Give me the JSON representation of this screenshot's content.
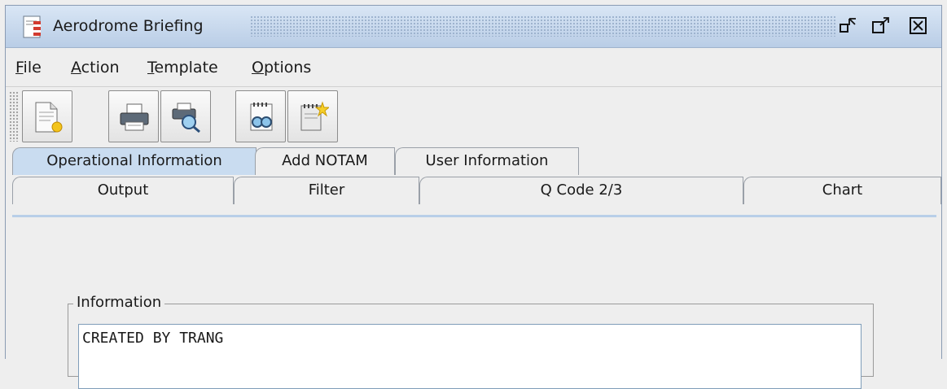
{
  "window": {
    "title": "Aerodrome Briefing",
    "controls": [
      "minimize-icon",
      "maximize-icon",
      "close-icon"
    ]
  },
  "menu": [
    {
      "mnemonic": "F",
      "rest": "ile"
    },
    {
      "mnemonic": "A",
      "rest": "ction"
    },
    {
      "mnemonic": "T",
      "rest": "emplate"
    },
    {
      "mnemonic": "O",
      "rest": "ptions"
    }
  ],
  "toolbar": {
    "buttons": [
      "new-document-icon",
      "print-icon",
      "print-preview-icon",
      "view-notam-icon",
      "new-notam-icon"
    ]
  },
  "tabs": {
    "row1": [
      "Operational Information",
      "Add NOTAM",
      "User Information"
    ],
    "row1_active": "Operational Information",
    "row2": [
      "Output",
      "Filter",
      "Q Code 2/3",
      "Chart"
    ]
  },
  "information": {
    "label": "Information",
    "text": "CREATED BY TRANG"
  },
  "colors": {
    "title_bar": "#c8d9ee",
    "active_tab": "#c9dcf0",
    "background": "#eeeeee"
  }
}
